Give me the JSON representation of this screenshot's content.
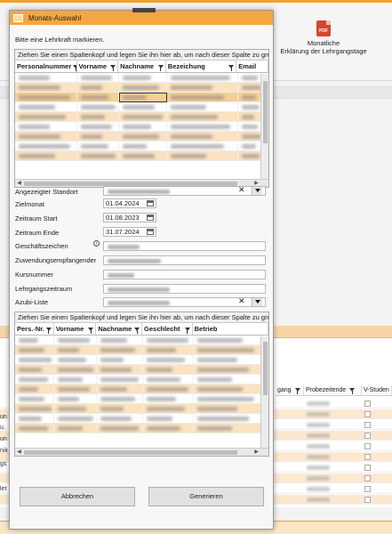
{
  "background": {
    "ribbon_button": {
      "label_line1": "Monatliche",
      "label_line2": "Erklärung der Lehrgangstage",
      "icon_text": "PDF"
    },
    "grid_headers": [
      "gang",
      "Probezeitende",
      "V-Studen"
    ],
    "left_labels": [
      "un",
      "u.",
      "un",
      "nik",
      "gs",
      "let"
    ]
  },
  "dialog": {
    "title": "Monats-Auswahl",
    "instruction": "Bitte eine Lehrkraft markieren.",
    "group_hint": "Ziehen Sie einen Spaltenkopf und legen Sie ihn hier ab, um nach dieser Spalte zu gruppie",
    "teacher_grid": {
      "columns": [
        "Personalnummer",
        "Vorname",
        "Nachname",
        "Bezeichung",
        "Email"
      ]
    },
    "form": {
      "standort_label": "Angezeigter Standort",
      "zielmonat_label": "Zielmonat",
      "zielmonat_value": "01.04.2024",
      "zeitraum_start_label": "Zeitraum Start",
      "zeitraum_start_value": "01.08.2023",
      "zeitraum_ende_label": "Zeitraum Ende",
      "zeitraum_ende_value": "31.07.2024",
      "geschaeftszeichen_label": "Geschäftszeichen",
      "zuwendung_label": "Zuwendungsempfangender",
      "kursnummer_label": "Kursnummer",
      "lehrgangszeitraum_label": "Lehrgangszeitraum",
      "azubi_label": "Azubi-Liste",
      "clear_symbol": "✕"
    },
    "student_grid": {
      "group_hint": "Ziehen Sie einen Spaltenkopf und legen Sie ihn hier ab, um nach dieser Spalte zu gruppie",
      "columns": [
        "Pers.-Nr.",
        "Vorname",
        "Nachname",
        "Geschlecht",
        "Betrieb"
      ]
    },
    "buttons": {
      "cancel": "Abbrechen",
      "generate": "Generieren"
    }
  }
}
